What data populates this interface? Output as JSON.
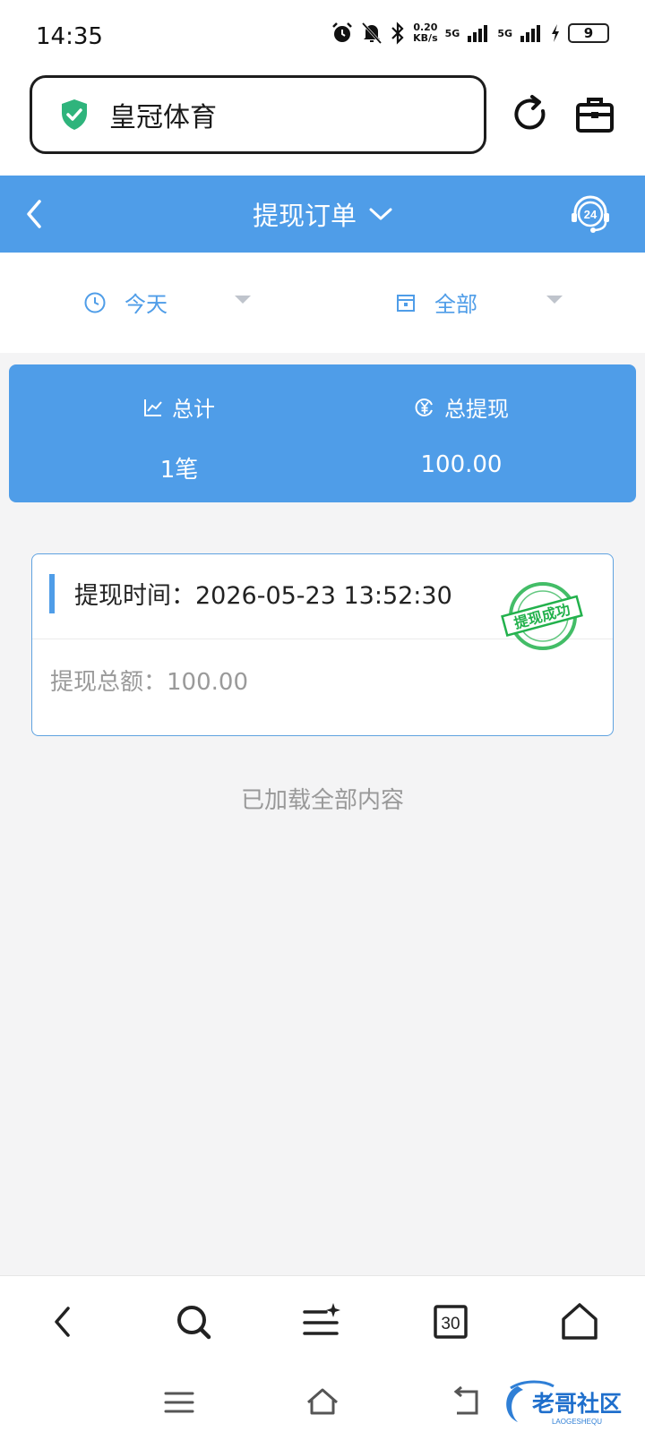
{
  "status_bar": {
    "time": "14:35",
    "net_speed": "0.20",
    "net_speed_unit": "KB/s",
    "network_1": "5G",
    "network_2": "5G",
    "battery": "9"
  },
  "browser": {
    "address_text": "皇冠体育"
  },
  "header": {
    "title": "提现订单"
  },
  "filters": {
    "date": "今天",
    "status": "全部"
  },
  "summary": {
    "count_label": "总计",
    "count_value": "1笔",
    "total_label": "总提现",
    "total_value": "100.00"
  },
  "orders": [
    {
      "time_label": "提现时间：",
      "time_value": "2026-05-23 13:52:30",
      "amount_label": "提现总额：",
      "amount_value": "100.00",
      "stamp_text": "提现成功"
    }
  ],
  "list_footer": "已加载全部内容",
  "bottom_toolbar": {
    "tabs_count": "30"
  },
  "watermark": {
    "text": "老哥社区",
    "subtext": "LAOGESHEQU"
  },
  "colors": {
    "primary": "#4f9de8",
    "stamp_green": "#22b14c",
    "shield_green": "#2fb47c"
  }
}
